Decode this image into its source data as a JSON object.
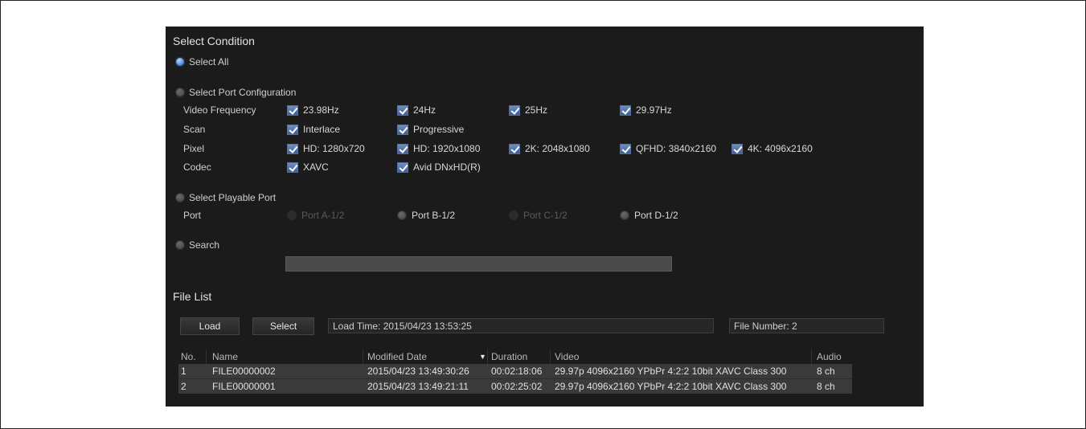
{
  "select_condition": {
    "title": "Select Condition",
    "select_all": "Select All",
    "select_port_config": "Select Port Configuration",
    "select_playable_port": "Select Playable Port",
    "search": "Search",
    "rows": {
      "video_frequency": {
        "label": "Video Frequency",
        "options": [
          "23.98Hz",
          "24Hz",
          "25Hz",
          "29.97Hz"
        ]
      },
      "scan": {
        "label": "Scan",
        "options": [
          "Interlace",
          "Progressive"
        ]
      },
      "pixel": {
        "label": "Pixel",
        "options": [
          "HD: 1280x720",
          "HD: 1920x1080",
          "2K: 2048x1080",
          "QFHD: 3840x2160",
          "4K: 4096x2160"
        ]
      },
      "codec": {
        "label": "Codec",
        "options": [
          "XAVC",
          "Avid DNxHD(R)"
        ]
      }
    },
    "port": {
      "label": "Port",
      "options": [
        "Port A-1/2",
        "Port B-1/2",
        "Port C-1/2",
        "Port D-1/2"
      ]
    },
    "search_value": ""
  },
  "file_list": {
    "title": "File List",
    "load_button": "Load",
    "select_button": "Select",
    "load_time": "Load Time: 2015/04/23 13:53:25",
    "file_number": "File Number: 2",
    "columns": [
      "No.",
      "Name",
      "Modified Date",
      "Duration",
      "Video",
      "Audio"
    ],
    "sort_icon": "sort-down-icon",
    "rows": [
      {
        "no": "1",
        "name": "FILE00000002",
        "modified": "2015/04/23 13:49:30:26",
        "duration": "00:02:18:06",
        "video": "29.97p 4096x2160 YPbPr 4:2:2 10bit XAVC Class 300",
        "audio": "8 ch"
      },
      {
        "no": "2",
        "name": "FILE00000001",
        "modified": "2015/04/23 13:49:21:11",
        "duration": "00:02:25:02",
        "video": "29.97p 4096x2160 YPbPr 4:2:2 10bit XAVC Class 300",
        "audio": "8 ch"
      }
    ]
  },
  "colors": {
    "panel": "#1b1b1b",
    "radio_selected": "#3d7fe0",
    "checkbox": "#4f6fa3"
  }
}
